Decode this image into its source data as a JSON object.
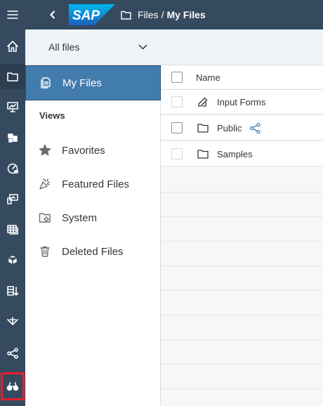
{
  "rail": {
    "items": [
      "menu-icon",
      "home-icon",
      "files-icon",
      "presentation-icon",
      "analytics-icon",
      "dashboard-icon",
      "stories-icon",
      "table-icon",
      "cube-icon",
      "sort-list-icon",
      "network-icon",
      "share-icon",
      "binoculars-icon"
    ]
  },
  "shellbar": {
    "logo": "SAP",
    "breadcrumb_parent": "Files",
    "breadcrumb_separator": "/",
    "breadcrumb_current": "My Files"
  },
  "filter": {
    "selected": "All files"
  },
  "sidenav": {
    "my_files": "My Files",
    "section": "Views",
    "items": [
      {
        "label": "Favorites",
        "icon": "star-icon"
      },
      {
        "label": "Featured Files",
        "icon": "party-popper-icon"
      },
      {
        "label": "System",
        "icon": "system-folder-icon"
      },
      {
        "label": "Deleted Files",
        "icon": "trash-icon"
      }
    ]
  },
  "table": {
    "column_name": "Name",
    "rows": [
      {
        "name": "Input Forms",
        "icon": "edit-icon"
      },
      {
        "name": "Public",
        "icon": "folder-icon"
      },
      {
        "name": "Samples",
        "icon": "folder-icon"
      }
    ]
  },
  "colors": {
    "shell": "#354a5f",
    "selected": "#427cac",
    "highlight": "#e5202e"
  }
}
